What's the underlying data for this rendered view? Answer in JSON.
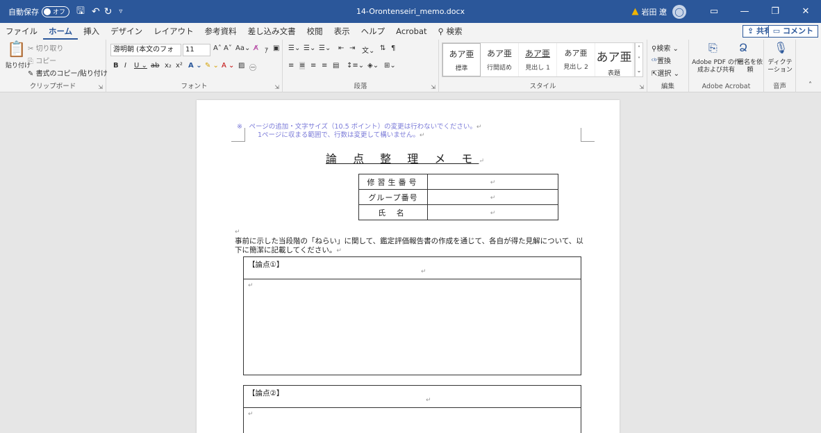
{
  "titlebar": {
    "autosave_label": "自動保存",
    "autosave_state": "オフ",
    "doc_title": "14-Orontenseiri_memo.docx",
    "user_name": "岩田 遼",
    "minimize": "—",
    "restore": "❐",
    "close": "✕"
  },
  "menu": {
    "tabs": [
      "ファイル",
      "ホーム",
      "挿入",
      "デザイン",
      "レイアウト",
      "参考資料",
      "差し込み文書",
      "校閲",
      "表示",
      "ヘルプ",
      "Acrobat"
    ],
    "search": "検索",
    "share": "共有",
    "comment": "コメント"
  },
  "ribbon": {
    "clipboard": {
      "paste": "貼り付け",
      "cut": "切り取り",
      "copy": "コピー",
      "format_painter": "書式のコピー/貼り付け",
      "label": "クリップボード"
    },
    "font": {
      "font_name": "游明朝 (本文のフォ",
      "font_size": "11",
      "label": "フォント"
    },
    "paragraph": {
      "label": "段落"
    },
    "styles": {
      "label": "スタイル",
      "items": [
        {
          "sample": "あア亜",
          "name": "標準"
        },
        {
          "sample": "あア亜",
          "name": "行間詰め"
        },
        {
          "sample": "あア亜",
          "name": "見出し 1"
        },
        {
          "sample": "あア亜",
          "name": "見出し 2"
        },
        {
          "sample": "あア亜",
          "name": "表題"
        }
      ]
    },
    "editing": {
      "find": "検索",
      "replace": "置換",
      "select": "選択",
      "label": "編集"
    },
    "acrobat": {
      "create_share": "Adobe PDF の作成および共有",
      "sign": "署名を依頼",
      "label": "Adobe Acrobat"
    },
    "voice": {
      "dictate": "ディクテーション",
      "label": "音声"
    }
  },
  "document": {
    "note_line1": "※　ページの追加・文字サイズ（10.5 ポイント）の変更は行わないでください。",
    "note_line2": "1ページに収まる範囲で、行数は変更して構いません。",
    "title": "論 点 整 理 メ モ",
    "info_rows": [
      {
        "label": "修習生番号"
      },
      {
        "label": "グループ番号"
      },
      {
        "label": "氏 名"
      }
    ],
    "instruction": "事前に示した当段階の「ねらい」に関して、鑑定評価報告書の作成を通じて、各自が得た見解について、以下に簡潔に記載してください。",
    "point1_heading": "【論点①】",
    "point2_heading": "【論点②】",
    "return_mark": "↵"
  }
}
